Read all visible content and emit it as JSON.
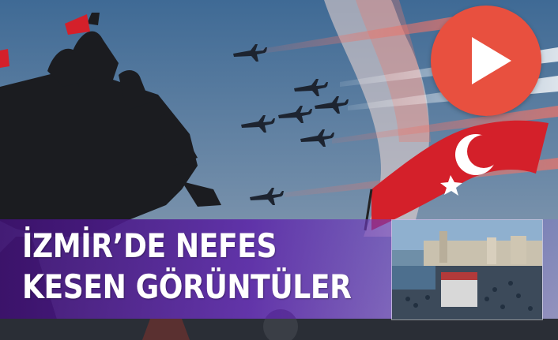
{
  "headline": {
    "line1": "İZMİR’DE NEFES",
    "line2": "KESEN GÖRÜNTÜLER"
  },
  "colors": {
    "accent": "#e8503f",
    "band": "#5c26a8",
    "flag": "#d4202a"
  },
  "icons": {
    "play": "play-icon"
  }
}
